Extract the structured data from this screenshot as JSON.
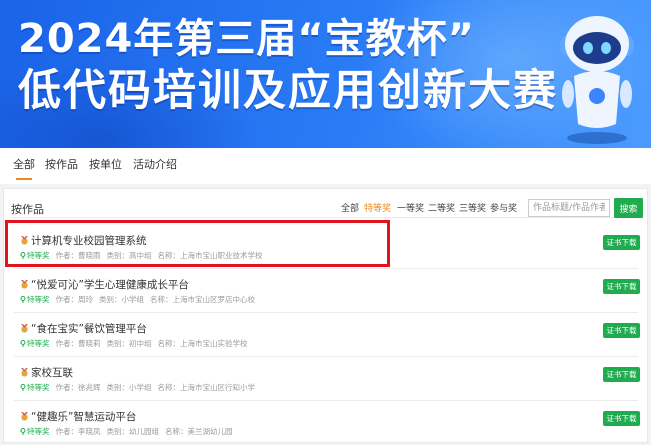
{
  "banner": {
    "title_line1": "2024年第三届“宝教杯”",
    "title_line2": "低代码培训及应用创新大赛",
    "robot_icon": "robot-mascot-icon"
  },
  "nav": {
    "tabs": [
      {
        "label": "全部",
        "active": true
      },
      {
        "label": "按作品",
        "active": false
      },
      {
        "label": "按单位",
        "active": false
      },
      {
        "label": "活动介绍",
        "active": false
      }
    ]
  },
  "list": {
    "title": "按作品",
    "filters": [
      {
        "label": "全部",
        "active": false
      },
      {
        "label": "特等奖",
        "active": true
      },
      {
        "label": "一等奖",
        "active": false
      },
      {
        "label": "二等奖",
        "active": false
      },
      {
        "label": "三等奖",
        "active": false
      },
      {
        "label": "参与奖",
        "active": false
      }
    ],
    "search_placeholder": "作品标题/作品作者",
    "search_button": "搜索",
    "meta_labels": {
      "author": "作者：",
      "category": "类别：",
      "org": "名称："
    },
    "cert_button": "证书下载",
    "rows": [
      {
        "title": "计算机专业校园管理系统",
        "level": "特等奖",
        "author": "曹晓雨",
        "category": "高中组",
        "org": "上海市宝山职业技术学校"
      },
      {
        "title": "“悦爱可沁”学生心理健康成长平台",
        "level": "特等奖",
        "author": "周玲",
        "category": "小学组",
        "org": "上海市宝山区罗店中心校"
      },
      {
        "title": "“食在宝实”餐饮管理平台",
        "level": "特等奖",
        "author": "曹晓莉",
        "category": "初中组",
        "org": "上海市宝山实验学校"
      },
      {
        "title": "家校互联",
        "level": "特等奖",
        "author": "徐兆辉",
        "category": "小学组",
        "org": "上海市宝山区行知小学"
      },
      {
        "title": "“健趣乐”智慧运动平台",
        "level": "特等奖",
        "author": "李晓凤",
        "category": "幼儿园组",
        "org": "美兰湖幼儿园"
      }
    ]
  },
  "colors": {
    "accent": "#f08a1a",
    "green": "#1eac4e",
    "banner_blue": "#1b63e8",
    "highlight_red": "#e0141e"
  }
}
